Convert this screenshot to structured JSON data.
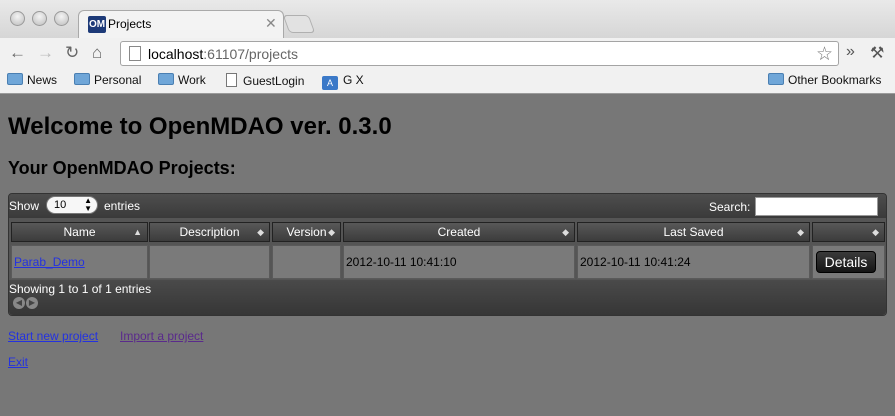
{
  "browser": {
    "tab_title": "Projects",
    "favicon_text": "OM",
    "url_host": "localhost",
    "url_rest": ":61107/projects",
    "bookmarks": [
      "News",
      "Personal",
      "Work",
      "GuestLogin",
      "G X"
    ],
    "other_bookmarks": "Other Bookmarks"
  },
  "page": {
    "title": "Welcome to OpenMDAO ver. 0.3.0",
    "subtitle": "Your OpenMDAO Projects:"
  },
  "table": {
    "show_label": "Show",
    "page_length": "10",
    "entries_label": "entries",
    "search_label": "Search:",
    "columns": [
      "Name",
      "Description",
      "Version",
      "Created",
      "Last Saved",
      ""
    ],
    "rows": [
      {
        "name": "Parab_Demo",
        "description": "",
        "version": "",
        "created": "2012-10-11 10:41:10",
        "last_saved": "2012-10-11 10:41:24",
        "action": "Details"
      }
    ],
    "info": "Showing 1 to 1 of 1 entries"
  },
  "links": {
    "start": "Start new project",
    "import": "Import a project",
    "exit": "Exit"
  },
  "colors": {
    "background": "#777777",
    "link": "#2432e0",
    "link_visited": "#5a2a8c"
  }
}
